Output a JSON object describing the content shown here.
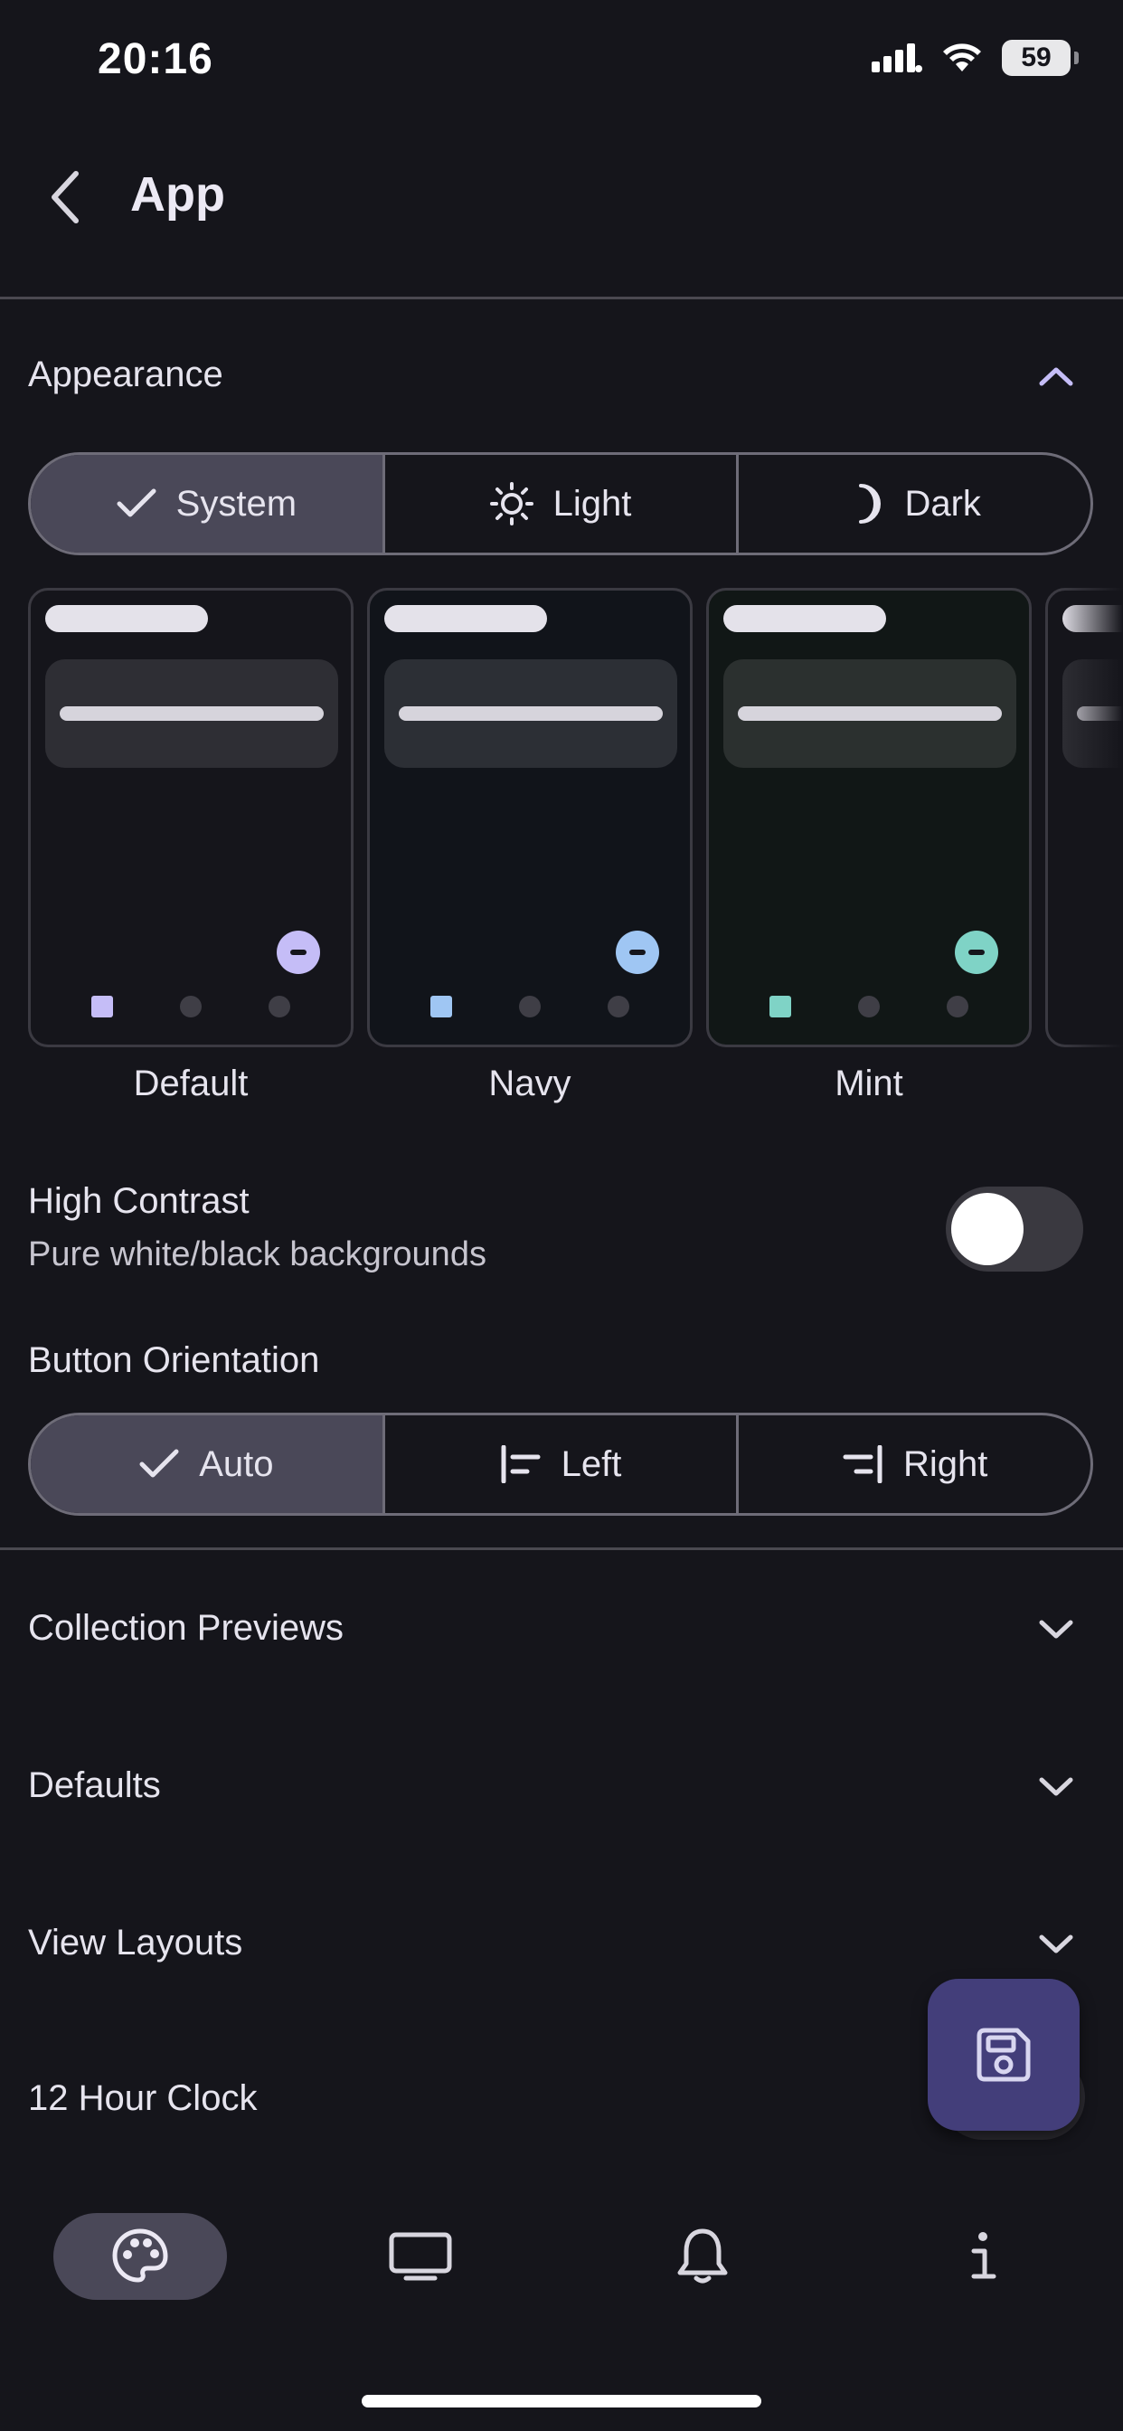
{
  "status_bar": {
    "time": "20:16",
    "battery": "59"
  },
  "header": {
    "title": "App"
  },
  "appearance": {
    "title": "Appearance",
    "mode_options": [
      {
        "label": "System",
        "icon": "check-icon",
        "selected": true
      },
      {
        "label": "Light",
        "icon": "sun-icon",
        "selected": false
      },
      {
        "label": "Dark",
        "icon": "moon-icon",
        "selected": false
      }
    ],
    "themes": [
      {
        "label": "Default",
        "accent": "#c5bdf7",
        "bg": "#15151b",
        "box": "#2e2e34"
      },
      {
        "label": "Navy",
        "accent": "#9fc6f3",
        "bg": "#11141a",
        "box": "#2c2f35"
      },
      {
        "label": "Mint",
        "accent": "#7fd3c6",
        "bg": "#111716",
        "box": "#2b302f"
      }
    ],
    "high_contrast": {
      "label": "High Contrast",
      "description": "Pure white/black backgrounds",
      "enabled": false
    },
    "button_orientation": {
      "label": "Button Orientation",
      "options": [
        {
          "label": "Auto",
          "icon": "check-icon",
          "selected": true
        },
        {
          "label": "Left",
          "icon": "align-left-icon",
          "selected": false
        },
        {
          "label": "Right",
          "icon": "align-right-icon",
          "selected": false
        }
      ]
    }
  },
  "sections": [
    {
      "label": "Collection Previews"
    },
    {
      "label": "Defaults"
    },
    {
      "label": "View Layouts"
    },
    {
      "label": "12 Hour Clock"
    }
  ],
  "bottom_nav": [
    {
      "icon": "palette-icon",
      "active": true
    },
    {
      "icon": "tv-icon",
      "active": false
    },
    {
      "icon": "bell-icon",
      "active": false
    },
    {
      "icon": "info-icon",
      "active": false
    }
  ],
  "colors": {
    "accent": "#c5bdf7",
    "fab": "#433e7a",
    "background": "#15151b"
  }
}
